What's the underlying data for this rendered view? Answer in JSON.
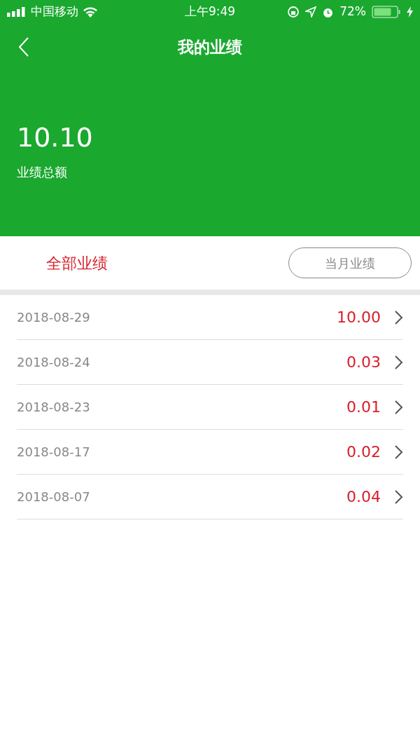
{
  "status_bar": {
    "carrier": "中国移动",
    "time": "上午9:49",
    "battery": "72%"
  },
  "nav": {
    "title": "我的业绩"
  },
  "summary": {
    "amount": "10.10",
    "label": "业绩总额"
  },
  "tabs": [
    {
      "label": "全部业绩",
      "selected": true
    },
    {
      "label": "当月业绩",
      "selected": false
    }
  ],
  "records": [
    {
      "date": "2018-08-29",
      "amount": "10.00"
    },
    {
      "date": "2018-08-24",
      "amount": "0.03"
    },
    {
      "date": "2018-08-23",
      "amount": "0.01"
    },
    {
      "date": "2018-08-17",
      "amount": "0.02"
    },
    {
      "date": "2018-08-07",
      "amount": "0.04"
    }
  ]
}
